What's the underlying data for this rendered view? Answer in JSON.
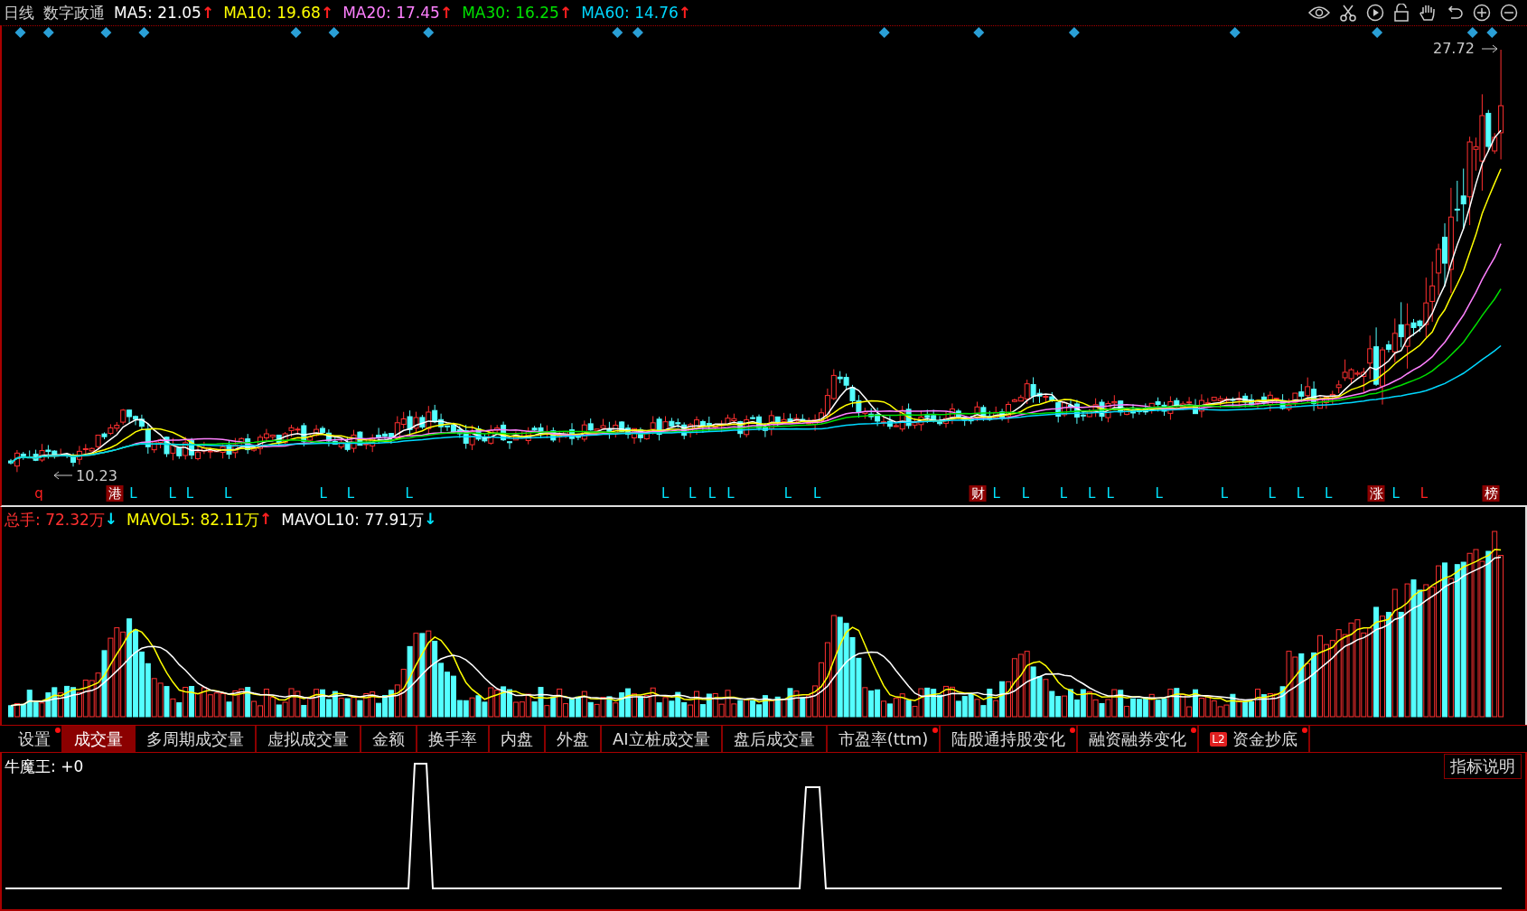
{
  "header": {
    "period": "日线",
    "stock": "数字政通",
    "ma": [
      {
        "label": "MA5: 21.05",
        "arrow": {
          "text": "↑",
          "color": "#ff2020"
        },
        "color": "#ffffff"
      },
      {
        "label": "MA10: 19.68",
        "arrow": {
          "text": "↑",
          "color": "#ff2020"
        },
        "color": "#ffff00"
      },
      {
        "label": "MA20: 17.45",
        "arrow": {
          "text": "↑",
          "color": "#ff2020"
        },
        "color": "#ff80ff"
      },
      {
        "label": "MA30: 16.25",
        "arrow": {
          "text": "↑",
          "color": "#ff2020"
        },
        "color": "#00e000"
      },
      {
        "label": "MA60: 14.76",
        "arrow": {
          "text": "↑",
          "color": "#ff2020"
        },
        "color": "#00d8ff"
      }
    ]
  },
  "price_chart": {
    "high_label": "27.72",
    "low_label": "10.23",
    "markers": [
      {
        "text": "q",
        "kind": "letter",
        "color": "#ff2020"
      },
      {
        "text": "港",
        "kind": "badge",
        "color": "#8b0000"
      },
      {
        "text": "L",
        "kind": "letter",
        "color": "#00e5ff"
      },
      {
        "text": "L",
        "kind": "letter",
        "color": "#00e5ff"
      },
      {
        "text": "L",
        "kind": "letter",
        "color": "#00e5ff"
      },
      {
        "text": "L",
        "kind": "letter",
        "color": "#00e5ff"
      },
      {
        "text": "L",
        "kind": "letter",
        "color": "#00e5ff"
      },
      {
        "text": "L",
        "kind": "letter",
        "color": "#00e5ff"
      },
      {
        "text": "L",
        "kind": "letter",
        "color": "#00e5ff"
      },
      {
        "text": "L",
        "kind": "letter",
        "color": "#00e5ff"
      },
      {
        "text": "L",
        "kind": "letter",
        "color": "#00e5ff"
      },
      {
        "text": "L",
        "kind": "letter",
        "color": "#00e5ff"
      },
      {
        "text": "L",
        "kind": "letter",
        "color": "#00e5ff"
      },
      {
        "text": "L",
        "kind": "letter",
        "color": "#00e5ff"
      },
      {
        "text": "L",
        "kind": "letter",
        "color": "#00e5ff"
      },
      {
        "text": "财",
        "kind": "badge",
        "color": "#8b0000"
      },
      {
        "text": "L",
        "kind": "letter",
        "color": "#00e5ff"
      },
      {
        "text": "L",
        "kind": "letter",
        "color": "#00e5ff"
      },
      {
        "text": "L",
        "kind": "letter",
        "color": "#00e5ff"
      },
      {
        "text": "L",
        "kind": "letter",
        "color": "#00e5ff"
      },
      {
        "text": "L",
        "kind": "letter",
        "color": "#00e5ff"
      },
      {
        "text": "L",
        "kind": "letter",
        "color": "#00e5ff"
      },
      {
        "text": "L",
        "kind": "letter",
        "color": "#00e5ff"
      },
      {
        "text": "L",
        "kind": "letter",
        "color": "#00e5ff"
      },
      {
        "text": "L",
        "kind": "letter",
        "color": "#00e5ff"
      },
      {
        "text": "L",
        "kind": "letter",
        "color": "#00e5ff"
      },
      {
        "text": "涨",
        "kind": "badge",
        "color": "#8b0000"
      },
      {
        "text": "L",
        "kind": "letter",
        "color": "#00e5ff"
      },
      {
        "text": "L",
        "kind": "letter",
        "color": "#ff2020"
      },
      {
        "text": "榜",
        "kind": "badge",
        "color": "#8b0000"
      }
    ]
  },
  "volume_panel": {
    "stats": [
      {
        "label": "总手: 72.32万",
        "arrow": {
          "text": "↓",
          "color": "#00e5ff"
        },
        "color": "#ff3030"
      },
      {
        "label": "MAVOL5: 82.11万",
        "arrow": {
          "text": "↑",
          "color": "#ff2020"
        },
        "color": "#ffff00"
      },
      {
        "label": "MAVOL10: 77.91万",
        "arrow": {
          "text": "↓",
          "color": "#00e5ff"
        },
        "color": "#ffffff"
      }
    ]
  },
  "tabs": [
    {
      "label": "设置",
      "selected": false,
      "dot": true
    },
    {
      "label": "成交量",
      "selected": true,
      "dot": false
    },
    {
      "label": "多周期成交量",
      "selected": false,
      "dot": false
    },
    {
      "label": "虚拟成交量",
      "selected": false,
      "dot": false
    },
    {
      "label": "金额",
      "selected": false,
      "dot": false
    },
    {
      "label": "换手率",
      "selected": false,
      "dot": false
    },
    {
      "label": "内盘",
      "selected": false,
      "dot": false
    },
    {
      "label": "外盘",
      "selected": false,
      "dot": false
    },
    {
      "label": "AI立桩成交量",
      "selected": false,
      "dot": false
    },
    {
      "label": "盘后成交量",
      "selected": false,
      "dot": false
    },
    {
      "label": "市盈率(ttm)",
      "selected": false,
      "dot": true
    },
    {
      "label": "陆股通持股变化",
      "selected": false,
      "dot": true
    },
    {
      "label": "融资融券变化",
      "selected": false,
      "dot": true
    },
    {
      "label": "资金抄底",
      "selected": false,
      "dot": true,
      "badge": "L2"
    }
  ],
  "indicator": {
    "label": "牛魔王: +0",
    "help_button": "指标说明"
  }
}
